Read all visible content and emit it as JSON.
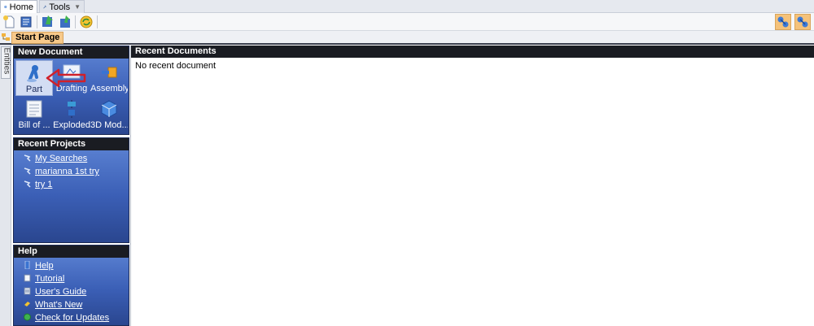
{
  "tabs": [
    {
      "label": "Home",
      "icon": "globe-icon",
      "active": true
    },
    {
      "label": "Tools",
      "icon": "wrench-icon",
      "active": false
    }
  ],
  "document_tab": {
    "label": "Start Page",
    "icon": "start-page-icon"
  },
  "side_panel": {
    "label": "Entities"
  },
  "new_document": {
    "title": "New Document",
    "items": [
      {
        "label": "Part",
        "icon": "part-icon",
        "selected": true
      },
      {
        "label": "Drafting",
        "icon": "drafting-icon",
        "selected": false
      },
      {
        "label": "Assembly",
        "icon": "assembly-icon",
        "selected": false
      },
      {
        "label": "Bill of ...",
        "icon": "bill-of-materials-icon",
        "selected": false
      },
      {
        "label": "Exploded",
        "icon": "exploded-icon",
        "selected": false
      },
      {
        "label": "3D Mod...",
        "icon": "3d-model-icon",
        "selected": false
      }
    ]
  },
  "recent_projects": {
    "title": "Recent Projects",
    "items": [
      {
        "label": "My Searches"
      },
      {
        "label": "marianna 1st try"
      },
      {
        "label": "try 1"
      }
    ]
  },
  "help": {
    "title": "Help",
    "items": [
      {
        "label": "Help",
        "icon": "help-icon"
      },
      {
        "label": "Tutorial",
        "icon": "tutorial-icon"
      },
      {
        "label": "User's Guide",
        "icon": "book-icon"
      },
      {
        "label": "What's New",
        "icon": "whats-new-icon"
      },
      {
        "label": "Check for Updates",
        "icon": "update-icon"
      }
    ]
  },
  "recent_documents": {
    "title": "Recent Documents",
    "empty_text": "No recent document"
  },
  "colors": {
    "panel_blue": "#3b5fb6",
    "header_dark": "#1a1c22",
    "tab_orange": "#f7c98a",
    "annotation_red": "#d0202a"
  }
}
